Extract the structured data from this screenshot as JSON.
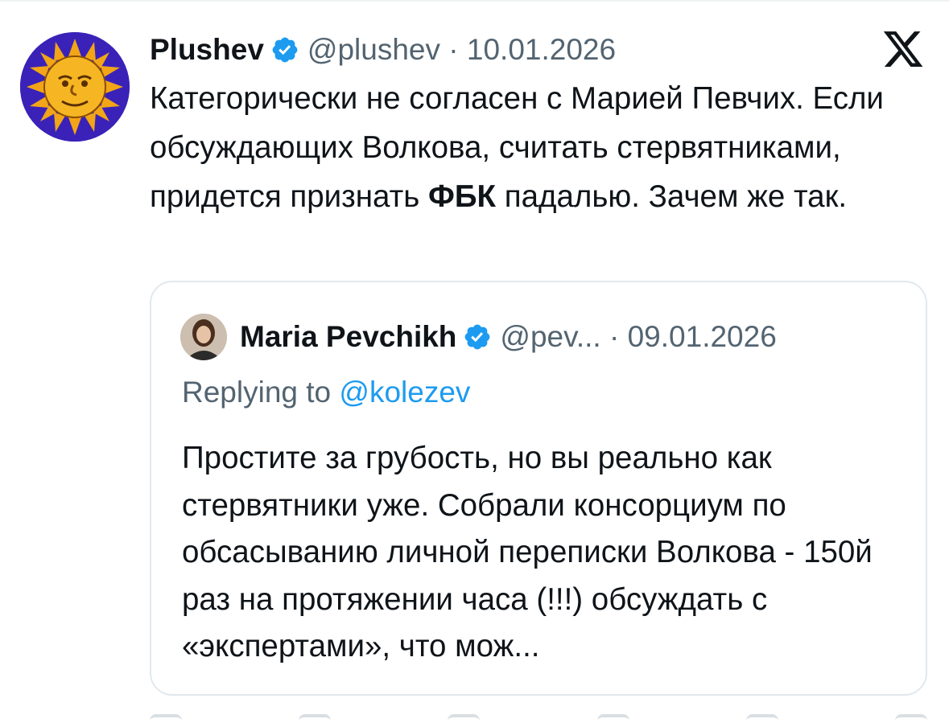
{
  "tweet": {
    "author_name": "Plushev",
    "handle": "@plushev",
    "separator": "·",
    "date": "10.01.2026",
    "text_part1": "Категорически не согласен с Марией Певчих. Если обсуждающих Волкова, считать стервятниками, придется признать ",
    "text_bold": "ФБК",
    "text_part2": " падалью. Зачем же так."
  },
  "quoted_tweet": {
    "author_name": "Maria Pevchikh",
    "handle": "@pev...",
    "separator": "·",
    "date": "09.01.2026",
    "replying_to_label": "Replying to",
    "replying_to_handle": "@kolezev",
    "text": "Простите за грубость, но вы реально как стервятники уже. Собрали консорциум по обсасыванию личной переписки Волкова - 150й раз на протяжении часа (!!!) обсуждать с «экспертами», что мож..."
  },
  "icons": {
    "verified": "verified-badge-icon",
    "platform": "x-logo-icon",
    "actions": [
      "reply-icon",
      "repost-icon",
      "like-icon",
      "views-icon",
      "bookmark-icon",
      "share-icon"
    ]
  },
  "colors": {
    "text_primary": "#0f1419",
    "text_secondary": "#536471",
    "verified_blue": "#1d9bf0",
    "mention_blue": "#1d9bf0",
    "card_border": "#e1e8ed"
  }
}
